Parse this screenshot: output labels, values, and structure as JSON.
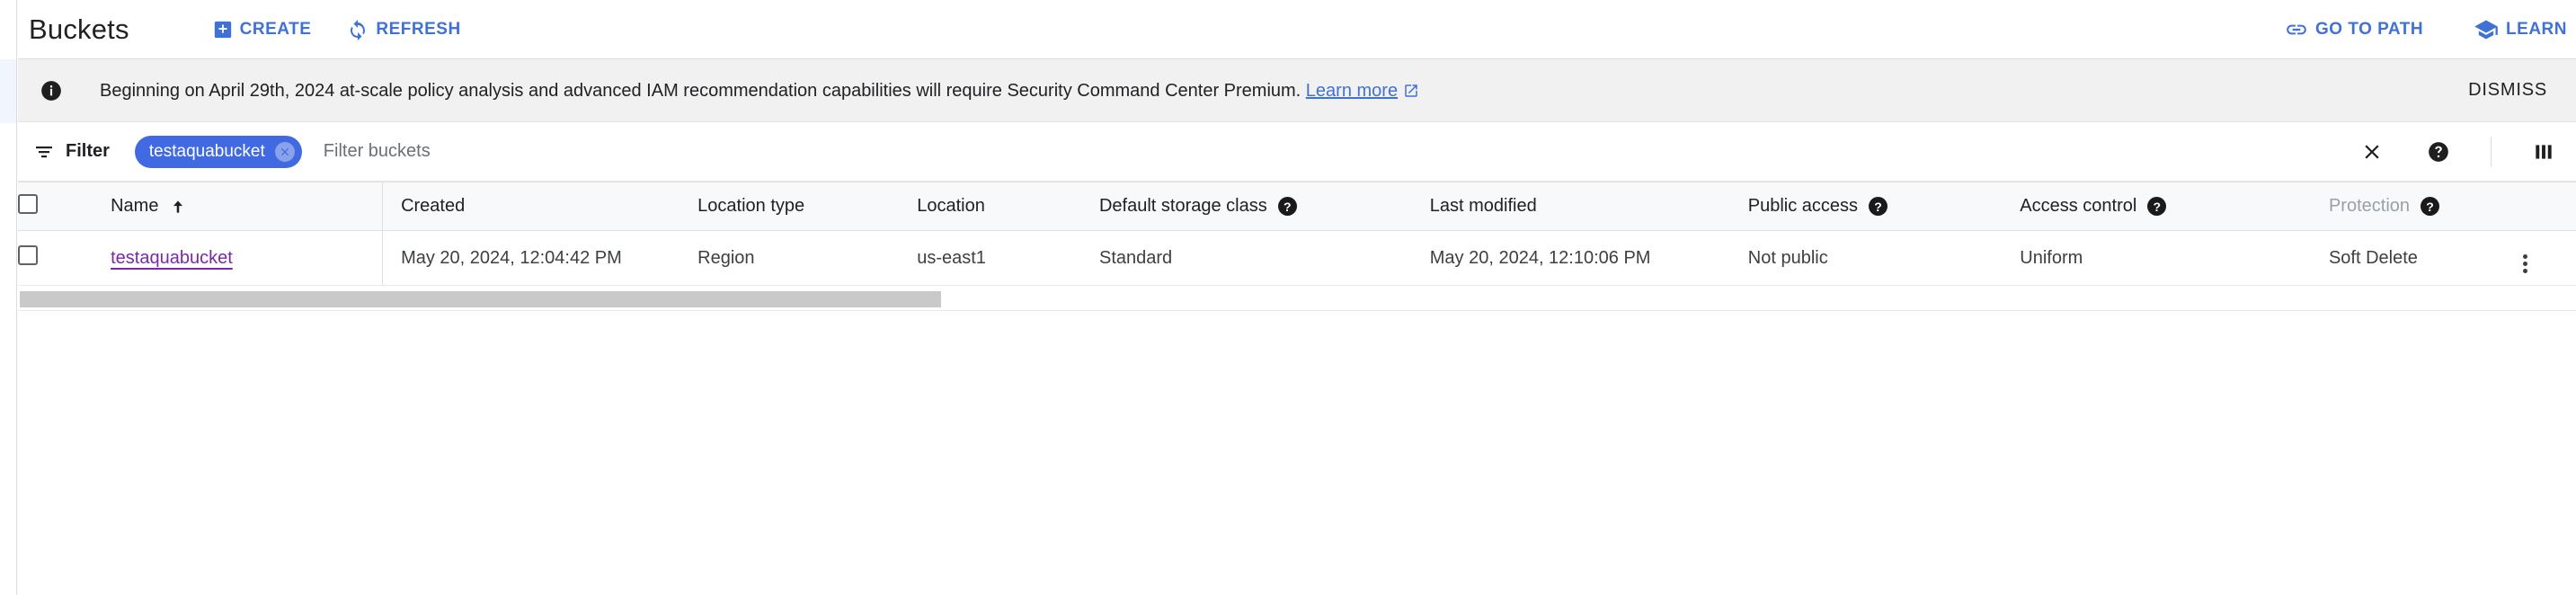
{
  "header": {
    "title": "Buckets",
    "actions": [
      {
        "label": "CREATE",
        "icon": "plus-square-icon"
      },
      {
        "label": "REFRESH",
        "icon": "refresh-icon"
      }
    ],
    "right_actions": [
      {
        "label": "GO TO PATH",
        "icon": "link-icon"
      },
      {
        "label": "LEARN",
        "icon": "graduation-cap-icon"
      }
    ]
  },
  "banner": {
    "icon": "info-icon",
    "text": "Beginning on April 29th, 2024 at-scale policy analysis and advanced IAM recommendation capabilities will require Security Command Center Premium.",
    "link_label": "Learn more",
    "link_icon": "open-in-new-icon",
    "dismiss_label": "DISMISS"
  },
  "filter_bar": {
    "label": "Filter",
    "icon": "filter-list-icon",
    "chip": {
      "label": "testaquabucket",
      "remove_icon": "chip-remove-icon"
    },
    "input_value": "",
    "placeholder": "Filter buckets",
    "clear_icon": "close-icon",
    "help_icon": "help-icon",
    "columns_icon": "column-display-options-icon"
  },
  "table": {
    "sort_column": "Name",
    "sort_direction": "ascending",
    "columns": [
      {
        "label": "Name",
        "help": false,
        "dim": false
      },
      {
        "label": "Created",
        "help": false,
        "dim": false
      },
      {
        "label": "Location type",
        "help": false,
        "dim": false
      },
      {
        "label": "Location",
        "help": false,
        "dim": false
      },
      {
        "label": "Default storage class",
        "help": true,
        "dim": false
      },
      {
        "label": "Last modified",
        "help": false,
        "dim": false
      },
      {
        "label": "Public access",
        "help": true,
        "dim": false
      },
      {
        "label": "Access control",
        "help": true,
        "dim": false
      },
      {
        "label": "Protection",
        "help": true,
        "dim": true
      }
    ],
    "help_glyph": "?",
    "rows": [
      {
        "name": "testaquabucket",
        "created": "May 20, 2024, 12:04:42 PM",
        "location_type": "Region",
        "location": "us-east1",
        "storage_class": "Standard",
        "last_modified": "May 20, 2024, 12:10:06 PM",
        "public_access": "Not public",
        "access_control": "Uniform",
        "protection": "Soft Delete",
        "menu_icon": "more-vert-icon"
      }
    ]
  },
  "colors": {
    "accent_blue": "#4071d4",
    "chip_blue": "#4169e1",
    "link_purple": "#7b28a8",
    "banner_bg": "#f1f1f1",
    "header_row_bg": "#f8f9fa"
  }
}
